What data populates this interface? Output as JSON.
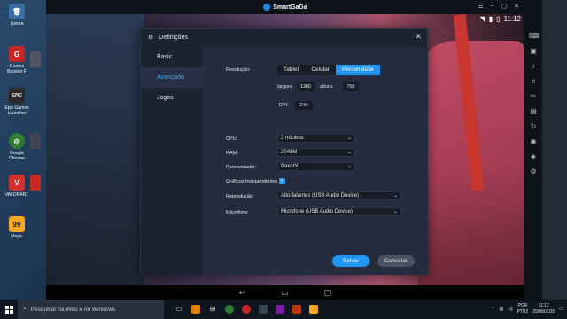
{
  "desktop": {
    "icons": [
      {
        "label": "Lixeira",
        "glyph": "🗑",
        "color": "#3a6ea5"
      },
      {
        "label": "Garena Booster F",
        "glyph": "G",
        "color": "#c62828"
      },
      {
        "label": "Epic Games Launcher",
        "glyph": "EPIC",
        "color": "#2b2b2b"
      },
      {
        "label": "Google Chrome",
        "glyph": "◎",
        "color": "#2e7d32"
      },
      {
        "label": "VALORANT",
        "glyph": "V",
        "color": "#d32f2f"
      },
      {
        "label": "Magic",
        "glyph": "99",
        "color": "#f9a825"
      }
    ]
  },
  "emulator": {
    "title": "SmartGaGa",
    "time": "11:12"
  },
  "dialog": {
    "title": "Definições",
    "nav": [
      "Basic",
      "Avançado",
      "Jogos"
    ],
    "active_nav": "Avançado",
    "resolution": {
      "label": "Resolução:",
      "options": [
        "Tablet",
        "Celular",
        "Personalizar"
      ],
      "selected": "Personalizar",
      "width_label": "largura",
      "width": "1360",
      "height_label": "altura:",
      "height": "768",
      "dpi_label": "DPI:",
      "dpi": "240"
    },
    "cpu": {
      "label": "CPU:",
      "value": "2 núcleos"
    },
    "ram": {
      "label": "RAM:",
      "value": "2048M"
    },
    "renderer": {
      "label": "Renderizador:",
      "value": "DirectX"
    },
    "graphics": {
      "label": "Gráficos Independentes",
      "checked": true
    },
    "playback": {
      "label": "Reprodução:",
      "value": "Alto-falantes (USB Audio Device)"
    },
    "microphone": {
      "label": "Microfone:",
      "value": "Microfone (USB Audio Device)"
    },
    "save": "Salvar",
    "cancel": "Cancelar"
  },
  "taskbar": {
    "search_placeholder": "Pesquisar na Web e no Windows",
    "lang": "POR",
    "layout": "PTB2",
    "time": "11:12",
    "date": "25/08/2020"
  }
}
